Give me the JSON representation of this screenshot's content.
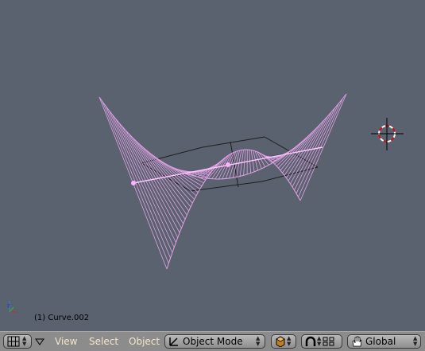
{
  "viewport": {
    "object_label": "(1) Curve.002",
    "background": "#5a6270",
    "surface_color": "#e2a2e6",
    "grid_color": "#1e1e1e"
  },
  "header": {
    "editor_type_icon": "grid-window-icon",
    "menus": [
      "View",
      "Select",
      "Object"
    ],
    "menu_color": "#f3e6c8",
    "mode": {
      "icon": "edit-mode-icon",
      "label": "Object Mode"
    },
    "draw_type_icon": "shaded-cube-icon",
    "pivot_icon": "magnet-icon",
    "layer_icon": "layers-icon",
    "transform": {
      "icon": "hand-icon",
      "label": "Global"
    }
  }
}
